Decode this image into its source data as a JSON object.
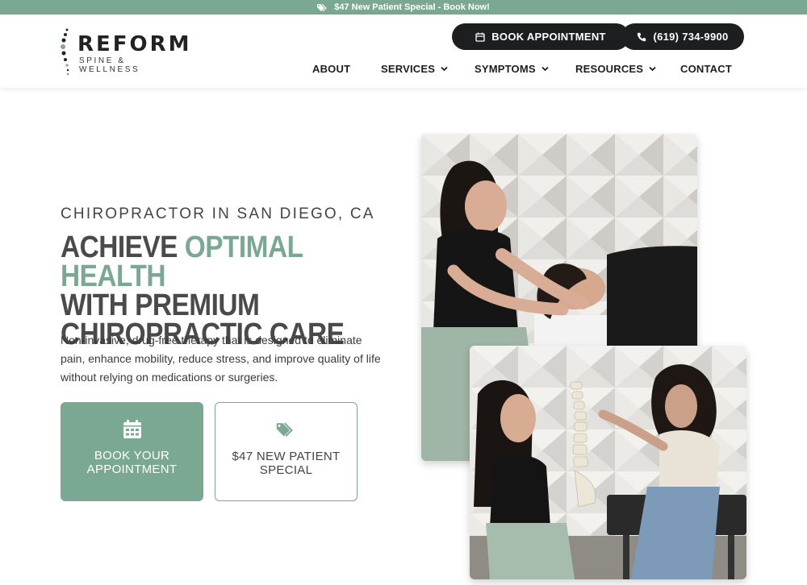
{
  "promo": {
    "text": "$47 New Patient Special - Book Now!",
    "icon": "tags-icon"
  },
  "brand": {
    "name": "REFORM",
    "tagline": "SPINE & WELLNESS",
    "accent": "#7ba892",
    "dark": "#1c1e20"
  },
  "header": {
    "book_label": "BOOK APPOINTMENT",
    "phone_label": "(619) 734-9900"
  },
  "nav": {
    "items": [
      {
        "label": "ABOUT",
        "has_dropdown": false
      },
      {
        "label": "SERVICES",
        "has_dropdown": true
      },
      {
        "label": "SYMPTOMS",
        "has_dropdown": true
      },
      {
        "label": "RESOURCES",
        "has_dropdown": true
      },
      {
        "label": "CONTACT",
        "has_dropdown": false
      }
    ]
  },
  "hero": {
    "eyebrow": "CHIROPRACTOR IN SAN DIEGO, CA",
    "headline_part1": "ACHIEVE ",
    "headline_accent": "OPTIMAL HEALTH",
    "headline_line2": "WITH PREMIUM",
    "headline_line3": "CHIROPRACTIC CARE",
    "lead": "Non-invasive, drug-free therapy that is designed to eliminate pain, enhance mobility, reduce stress, and improve quality of life without relying on medications or surgeries.",
    "cta_primary": {
      "line1": "BOOK YOUR",
      "line2": "APPOINTMENT",
      "icon": "calendar-icon"
    },
    "cta_secondary": {
      "line1": "$47 NEW PATIENT",
      "line2": "SPECIAL",
      "icon": "tag-icon"
    }
  }
}
